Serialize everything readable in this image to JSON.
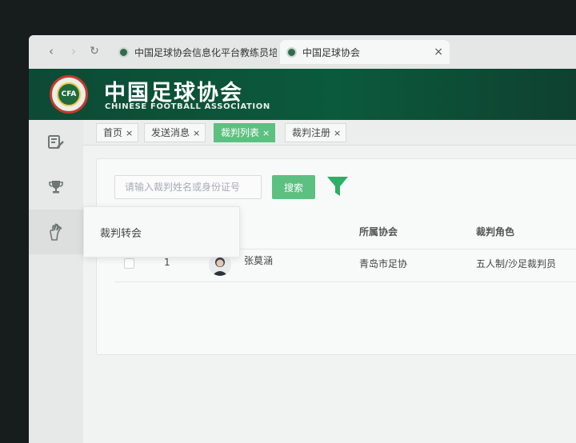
{
  "browser": {
    "tabs": [
      {
        "title": "中国足球协会信息化平台教练员培"
      },
      {
        "title": "中国足球协会"
      }
    ]
  },
  "header": {
    "title": "中国足球协会",
    "subtitle": "CHINESE FOOTBALL ASSOCIATION",
    "logo_text": "CFA"
  },
  "sidebar": {
    "icons": [
      "edit-list-icon",
      "trophy-icon",
      "whistle-hand-icon"
    ]
  },
  "page_tabs": [
    {
      "label": "首页",
      "close": "×"
    },
    {
      "label": "发送消息",
      "close": "×"
    },
    {
      "label": "裁判列表",
      "close": "×"
    },
    {
      "label": "裁判注册",
      "close": "×"
    }
  ],
  "search": {
    "placeholder": "请输入裁判姓名或身份证号",
    "button_label": "搜索"
  },
  "table": {
    "headers": [
      "所属协会",
      "裁判角色"
    ],
    "rows": [
      {
        "index": "1",
        "name": "张莫涵",
        "association": "青岛市足协",
        "role": "五人制/沙足裁判员"
      }
    ]
  },
  "dropdown": {
    "item": "裁判转会"
  },
  "colors": {
    "brand_green": "#0b5a3d",
    "accent_green": "#5cc081"
  }
}
